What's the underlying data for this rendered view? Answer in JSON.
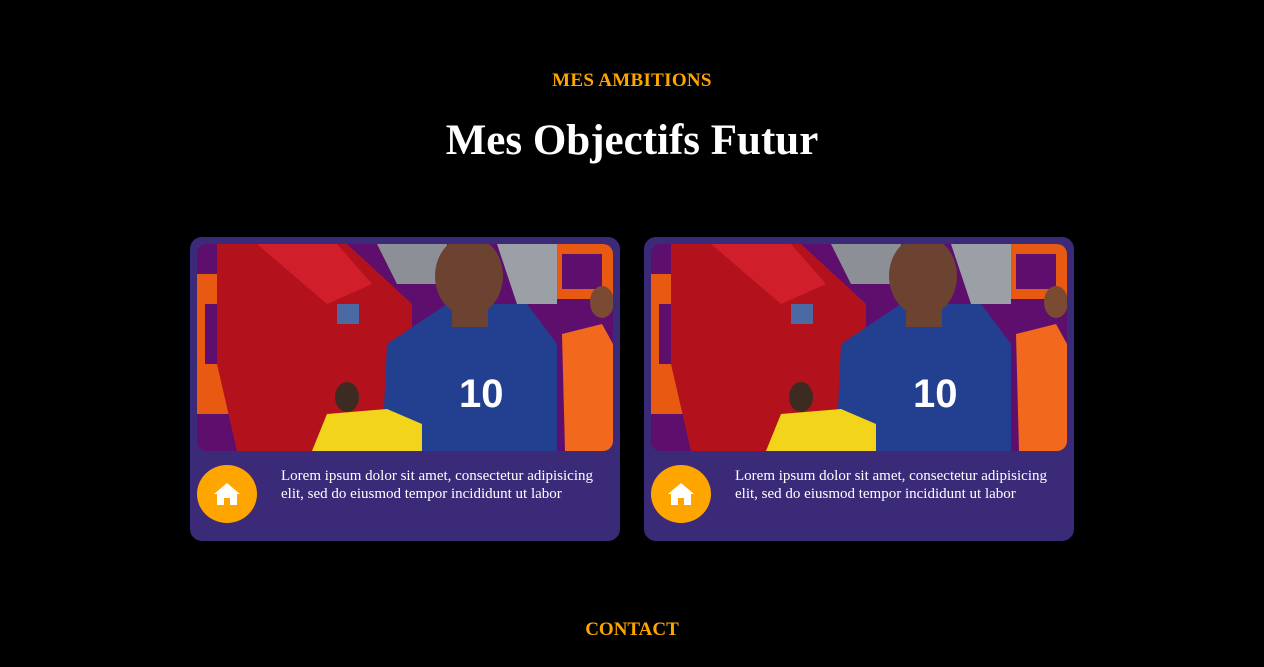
{
  "section": {
    "eyebrow": "MES AMBITIONS",
    "title": "Mes Objectifs Futur"
  },
  "cards": [
    {
      "icon": "home-icon",
      "text": "Lorem ipsum dolor sit amet, consectetur adipisicing elit, sed do eiusmod tempor incididunt ut labor",
      "image_caption": "10"
    },
    {
      "icon": "home-icon",
      "text": "Lorem ipsum dolor sit amet, consectetur adipisicing elit, sed do eiusmod tempor incididunt ut labor",
      "image_caption": "10"
    }
  ],
  "contact": {
    "heading": "CONTACT"
  },
  "colors": {
    "background": "#000000",
    "accent": "#ffa500",
    "card": "#3a2a78",
    "heading": "#ffffff"
  }
}
